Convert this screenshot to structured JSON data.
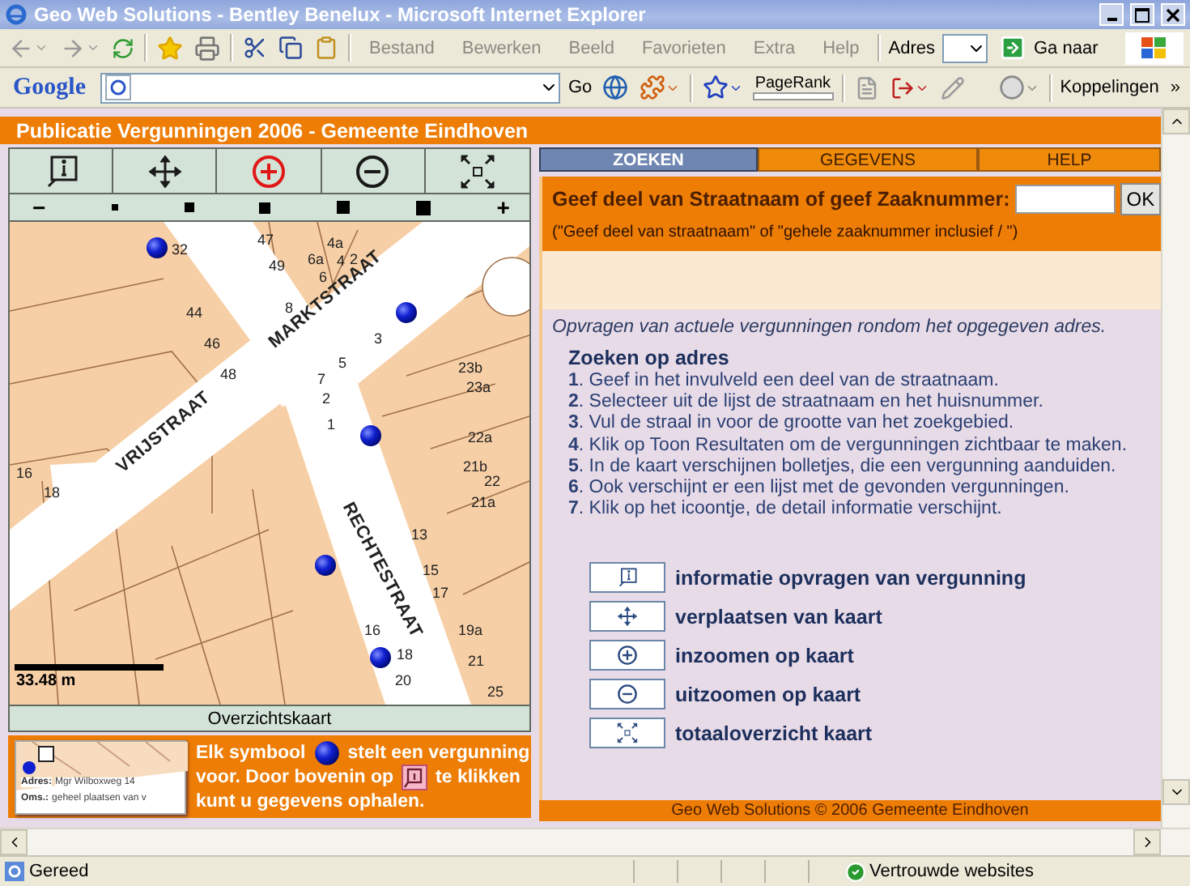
{
  "browser": {
    "title": "Geo Web Solutions - Bentley Benelux - Microsoft Internet Explorer",
    "menu": [
      "Bestand",
      "Bewerken",
      "Beeld",
      "Favorieten",
      "Extra",
      "Help"
    ],
    "address_label": "Adres",
    "go_button": "Ga naar",
    "google_logo": "Google",
    "google_go": "Go",
    "pagerank": "PageRank",
    "links": "Koppelingen",
    "more": "»"
  },
  "page": {
    "header": "Publicatie Vergunningen 2006 - Gemeente Eindhoven",
    "map_tools": [
      {
        "kind": "info",
        "selected": false
      },
      {
        "kind": "pan",
        "selected": false
      },
      {
        "kind": "zoom-in",
        "selected": true
      },
      {
        "kind": "zoom-out",
        "selected": false
      },
      {
        "kind": "full-extent",
        "selected": false
      }
    ],
    "zoom_bar": {
      "minus": "−",
      "plus": "+"
    },
    "map": {
      "streets": [
        {
          "name": "VRIJSTRAAT"
        },
        {
          "name": "MARKTSTRAAT"
        },
        {
          "name": "RECHTESTRAAT"
        }
      ],
      "house_numbers": [
        "47",
        "4a",
        "6a",
        "4",
        "2",
        "49",
        "6",
        "8",
        "32",
        "44",
        "46",
        "48",
        "3",
        "5",
        "7",
        "23b",
        "23a",
        "2",
        "1",
        "22a",
        "21b",
        "22",
        "21a",
        "16",
        "18",
        "13",
        "15",
        "17",
        "16",
        "19a",
        "18",
        "21",
        "20",
        "25"
      ],
      "scale": "33.48 m"
    },
    "overview_button": "Overzichtskaart",
    "legend": {
      "card": {
        "address_label": "Adres:",
        "address": "Mgr Wilboxweg 14",
        "desc_label": "Oms.:",
        "desc": "geheel plaatsen van v"
      },
      "lines": [
        [
          {
            "kind": "text",
            "text": "Elk symbool"
          },
          {
            "kind": "dot"
          },
          {
            "kind": "text",
            "text": "stelt een vergunning"
          }
        ],
        [
          {
            "kind": "text",
            "text": "voor.  Door bovenin op"
          },
          {
            "kind": "info"
          },
          {
            "kind": "text",
            "text": "te klikken"
          }
        ],
        [
          {
            "kind": "text",
            "text": "kunt u gegevens ophalen."
          }
        ]
      ]
    },
    "tabs": [
      {
        "label": "ZOEKEN",
        "selected": true
      },
      {
        "label": "GEGEVENS",
        "selected": false
      },
      {
        "label": "HELP",
        "selected": false
      }
    ],
    "search": {
      "label": "Geef deel van Straatnaam of geef Zaaknummer:",
      "button": "OK",
      "hint": "(\"Geef deel van straatnaam\" of \"gehele zaaknummer inclusief / \")"
    },
    "intro": "Opvragen van actuele vergunningen rondom het opgegeven adres.",
    "section_title": "Zoeken op adres",
    "steps": [
      {
        "number": "1",
        "text": ". Geef in het invulveld een deel van de straatnaam."
      },
      {
        "number": "2",
        "text": ". Selecteer uit de lijst de straatnaam en het huisnummer."
      },
      {
        "number": "3",
        "text": ". Vul de straal in voor de grootte van het zoekgebied."
      },
      {
        "number": "4",
        "text": ". Klik op Toon Resultaten om de vergunningen zichtbaar te maken."
      },
      {
        "number": "5",
        "text": ". In de kaart verschijnen bolletjes, die een vergunning aanduiden."
      },
      {
        "number": "6",
        "text": ". Ook verschijnt er een lijst met de gevonden vergunningen."
      },
      {
        "number": "7",
        "text": ". Klik op het icoontje, de detail informatie verschijnt."
      }
    ],
    "tool_legend": [
      {
        "kind": "info",
        "label": "informatie opvragen van vergunning"
      },
      {
        "kind": "pan",
        "label": "verplaatsen van kaart"
      },
      {
        "kind": "zoom-in",
        "label": "inzoomen op kaart"
      },
      {
        "kind": "zoom-out",
        "label": "uitzoomen op kaart"
      },
      {
        "kind": "full-extent",
        "label": "totaaloverzicht kaart"
      }
    ],
    "footer": "Geo Web Solutions © 2006 Gemeente Eindhoven"
  },
  "status": {
    "text": "Gereed",
    "zone": "Vertrouwde websites"
  }
}
